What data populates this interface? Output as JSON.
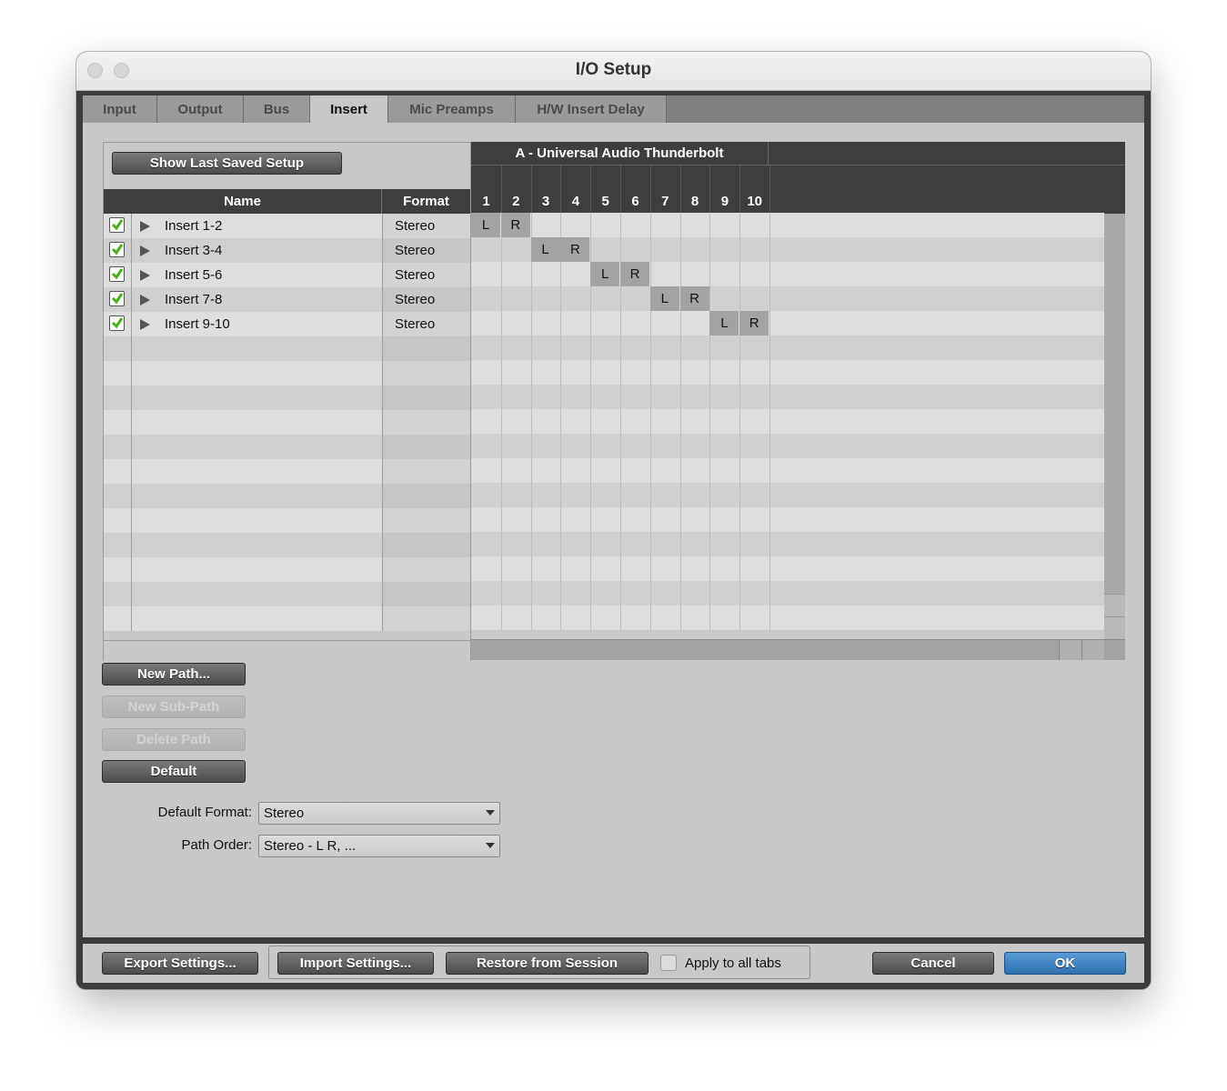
{
  "window": {
    "title": "I/O Setup"
  },
  "tabs": [
    {
      "label": "Input",
      "active": false
    },
    {
      "label": "Output",
      "active": false
    },
    {
      "label": "Bus",
      "active": false
    },
    {
      "label": "Insert",
      "active": true
    },
    {
      "label": "Mic Preamps",
      "active": false
    },
    {
      "label": "H/W Insert Delay",
      "active": false
    }
  ],
  "table": {
    "show_last_saved_label": "Show Last Saved Setup",
    "col_name": "Name",
    "col_format": "Format",
    "device": "A - Universal Audio Thunderbolt",
    "channels": [
      "1",
      "2",
      "3",
      "4",
      "5",
      "6",
      "7",
      "8",
      "9",
      "10"
    ],
    "rows": [
      {
        "name": "Insert 1-2",
        "format": "Stereo",
        "checked": true,
        "l": "L",
        "r": "R"
      },
      {
        "name": "Insert 3-4",
        "format": "Stereo",
        "checked": true,
        "l": "L",
        "r": "R"
      },
      {
        "name": "Insert 5-6",
        "format": "Stereo",
        "checked": true,
        "l": "L",
        "r": "R"
      },
      {
        "name": "Insert 7-8",
        "format": "Stereo",
        "checked": true,
        "l": "L",
        "r": "R"
      },
      {
        "name": "Insert 9-10",
        "format": "Stereo",
        "checked": true,
        "l": "L",
        "r": "R"
      }
    ]
  },
  "path_buttons": {
    "new_path": "New Path...",
    "new_sub_path": "New Sub-Path",
    "delete_path": "Delete Path",
    "default": "Default"
  },
  "settings": {
    "default_format_label": "Default Format:",
    "default_format_value": "Stereo",
    "path_order_label": "Path Order:",
    "path_order_value": "Stereo - L R, ..."
  },
  "footer": {
    "export": "Export Settings...",
    "import": "Import Settings...",
    "restore": "Restore from Session",
    "apply_all": "Apply to all tabs",
    "apply_all_checked": false,
    "cancel": "Cancel",
    "ok": "OK"
  },
  "colors": {
    "accent_ok": "#2e6fae",
    "check_green": "#4caf1a"
  }
}
